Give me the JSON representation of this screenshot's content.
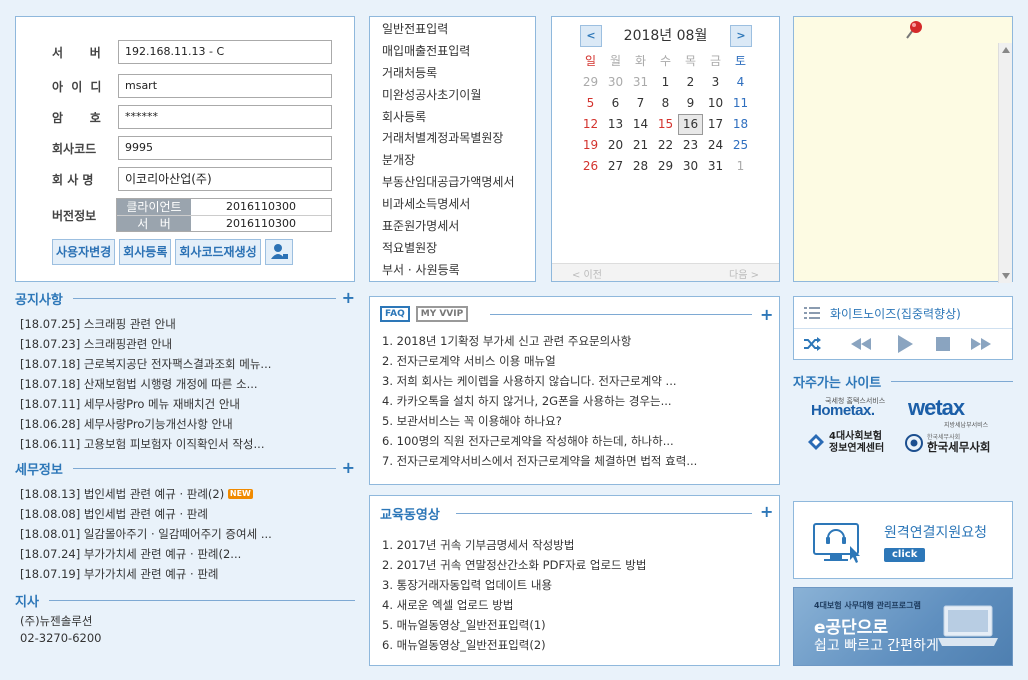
{
  "login": {
    "server_label": "서    버",
    "server_value": "192.168.11.13 - C",
    "id_label": "아 이 디",
    "id_value": "msart",
    "pw_label": "암    호",
    "pw_value": "******",
    "company_code_label": "회사코드",
    "company_code_value": "9995",
    "company_name_label": "회 사 명",
    "company_name_value": "이코리아산업(주)",
    "version_label": "버전정보",
    "version_client_label": "클라이언트",
    "version_client_value": "2016110300",
    "version_server_label": "서   버",
    "version_server_value": "2016110300",
    "buttons": [
      "사용자변경",
      "회사등록",
      "회사코드재생성"
    ]
  },
  "menu": {
    "items": [
      "일반전표입력",
      "매입매출전표입력",
      "거래처등록",
      "미완성공사초기이월",
      "회사등록",
      "거래처별계정과목별원장",
      "분개장",
      "부동산임대공급가액명세서",
      "비과세소득명세서",
      "표준원가명세서",
      "적요별원장",
      "부서 · 사원등록"
    ]
  },
  "calendar": {
    "title": "2018년 08월",
    "prev": "<",
    "next": ">",
    "weekdays": [
      "일",
      "월",
      "화",
      "수",
      "목",
      "금",
      "토"
    ],
    "weeks": [
      [
        "29",
        "30",
        "31",
        "1",
        "2",
        "3",
        "4"
      ],
      [
        "5",
        "6",
        "7",
        "8",
        "9",
        "10",
        "11"
      ],
      [
        "12",
        "13",
        "14",
        "15",
        "16",
        "17",
        "18"
      ],
      [
        "19",
        "20",
        "21",
        "22",
        "23",
        "24",
        "25"
      ],
      [
        "26",
        "27",
        "28",
        "29",
        "30",
        "31",
        "1"
      ]
    ],
    "today": "16",
    "prev_label": "< 이전",
    "next_label": "다음 >"
  },
  "notice": {
    "title": "공지사항",
    "items": [
      "[18.07.25] 스크래핑 관련 안내",
      "[18.07.23] 스크래핑관련 안내",
      "[18.07.18] 근로복지공단 전자팩스결과조회 메뉴...",
      "[18.07.18] 산재보험법 시행령 개정에 따른 소...",
      "[18.07.11] 세무사랑Pro 메뉴 재배치건 안내",
      "[18.06.28] 세무사랑Pro기능개선사항 안내",
      "[18.06.11] 고용보험 피보험자 이직확인서 작성..."
    ]
  },
  "tax": {
    "title": "세무정보",
    "items": [
      "[18.08.13] 법인세법 관련 예규 · 판례(2)",
      "[18.08.08] 법인세법 관련 예규 · 판례",
      "[18.08.01] 일감몰아주기 · 일감떼어주기 증여세 ...",
      "[18.07.24] 부가가치세 관련 예규 · 판례(2...",
      "[18.07.19] 부가가치세 관련 예규 · 판례"
    ],
    "new_badge": "NEW"
  },
  "branch": {
    "title": "지사",
    "name": "(주)뉴젠솔루션",
    "phone": "02-3270-6200"
  },
  "faq": {
    "tabs": [
      "FAQ",
      "MY VVIP"
    ],
    "items": [
      "1. 2018년 1기확정 부가세 신고 관련 주요문의사항",
      "2. 전자근로계약 서비스 이용 매뉴얼",
      "3. 저희 회사는 케이렙을 사용하지 않습니다. 전자근로계약 ...",
      "4. 카카오톡을 설치 하지 않거나, 2G폰을 사용하는 경우는...",
      "5. 보관서비스는 꼭 이용해야 하나요?",
      "6. 100명의 직원 전자근로계약을 작성해야 하는데, 하나하...",
      "7. 전자근로계약서비스에서 전자근로계약을 체결하면 법적 효력..."
    ]
  },
  "edu": {
    "title": "교육동영상",
    "items": [
      "1. 2017년 귀속 기부금명세서 작성방법",
      "2. 2017년 귀속 연말정산간소화 PDF자료 업로드 방법",
      "3. 통장거래자동입력 업데이트 내용",
      "4. 새로운 엑셀 업로드 방법",
      "5. 매뉴얼동영상_일반전표입력(1)",
      "6. 매뉴얼동영상_일반전표입력(2)"
    ]
  },
  "player": {
    "title": "화이트노이즈(집중력향상)"
  },
  "sites": {
    "title": "자주가는 사이트",
    "hometax": "Hometax.",
    "hometax_sub": "국세청 홈택스서비스",
    "wetax": "wetax",
    "wetax_sub": "지방세납부서비스",
    "insurance": "4대사회보험",
    "insurance_sub": "정보연계센터",
    "kacpta_small": "한국세무사회",
    "kacpta": "한국세무사회"
  },
  "remote": {
    "title": "원격연결지원요청",
    "click": "click"
  },
  "promo": {
    "line1": "4대보험 사무대행 관리프로그램",
    "line2": "e공단으로",
    "line3": "쉽고 빠르고 간편하게"
  },
  "colors": {
    "accent": "#2d77b8",
    "border": "#8fb8dc",
    "background": "#e9f2fa",
    "memo": "#fdfbe3"
  }
}
